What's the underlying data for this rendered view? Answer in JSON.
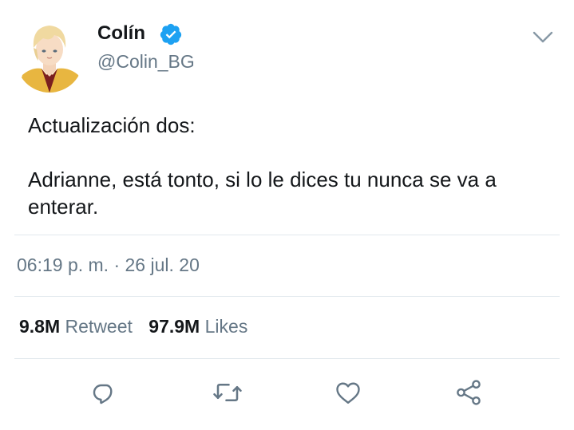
{
  "user": {
    "display_name": "Colín",
    "handle": "@Colin_BG",
    "verified": true
  },
  "tweet": {
    "line1": "Actualización dos:",
    "line2": "Adrianne, está tonto, si lo le dices tu nunca se va a enterar."
  },
  "meta": {
    "timestamp": "06:19 p. m. · 26 jul. 20"
  },
  "stats": {
    "retweets_count": "9.8M",
    "retweets_label": "Retweet",
    "likes_count": "97.9M",
    "likes_label": "Likes"
  },
  "actions": {
    "icons": [
      "reply-icon",
      "retweet-icon",
      "like-icon",
      "share-icon"
    ]
  },
  "colors": {
    "accent": "#1da1f2",
    "secondary_text": "#657786",
    "divider": "#e1e8ed"
  }
}
